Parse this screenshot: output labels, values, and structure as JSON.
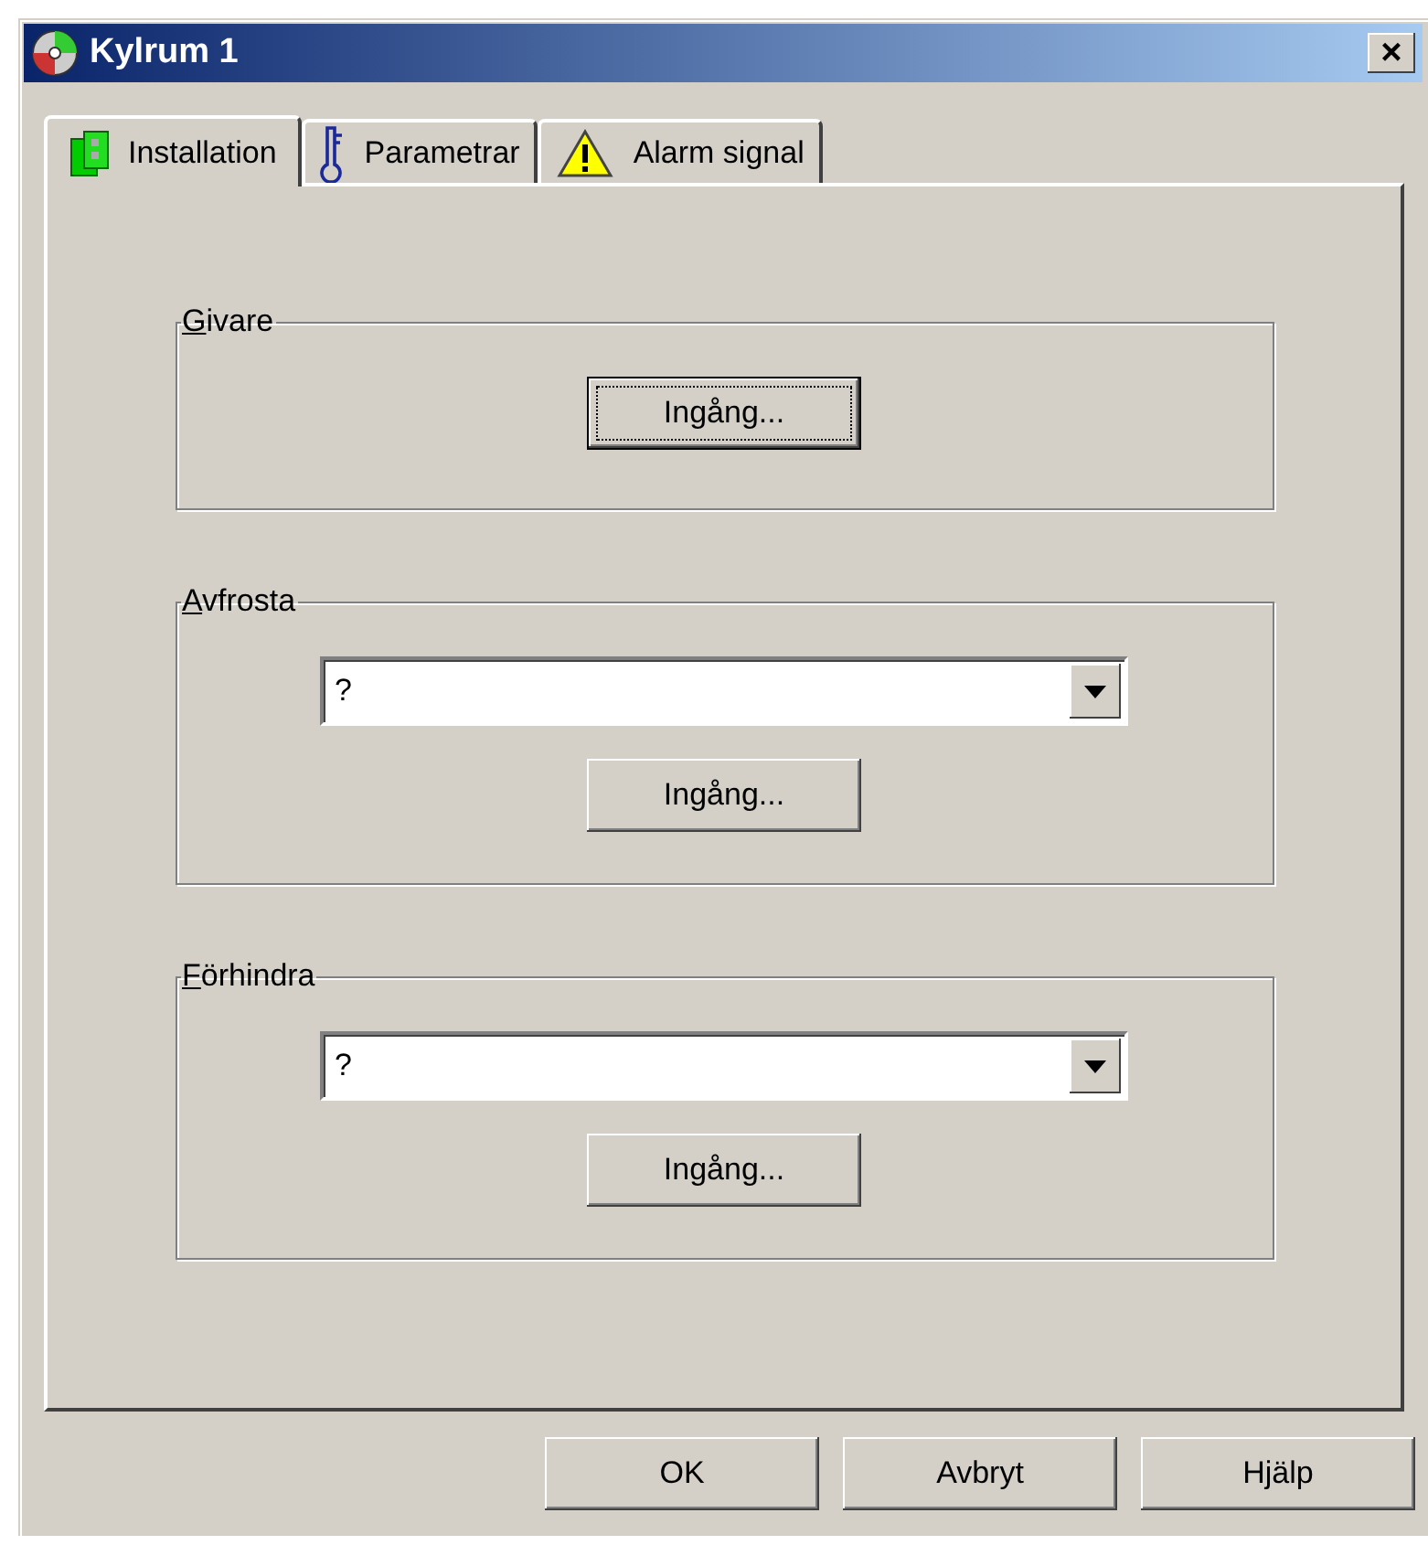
{
  "window": {
    "title": "Kylrum 1",
    "close": "×"
  },
  "tabs": [
    {
      "label": "Installation",
      "selected": true
    },
    {
      "label": "Parametrar",
      "selected": false
    },
    {
      "label": "Alarm signal",
      "selected": false
    }
  ],
  "groups": [
    {
      "title": "Givare",
      "kind": "button",
      "button": {
        "label": "Ingång...",
        "focused": true
      }
    },
    {
      "title": "Avfrosta",
      "kind": "combo_button",
      "combo": {
        "value": "?"
      },
      "button": {
        "label": "Ingång...",
        "focused": false
      }
    },
    {
      "title": "Förhindra",
      "kind": "combo_button",
      "combo": {
        "value": "?"
      },
      "button": {
        "label": "Ingång...",
        "focused": false
      }
    }
  ],
  "buttons": [
    "OK",
    "Avbryt",
    "Hjälp"
  ]
}
